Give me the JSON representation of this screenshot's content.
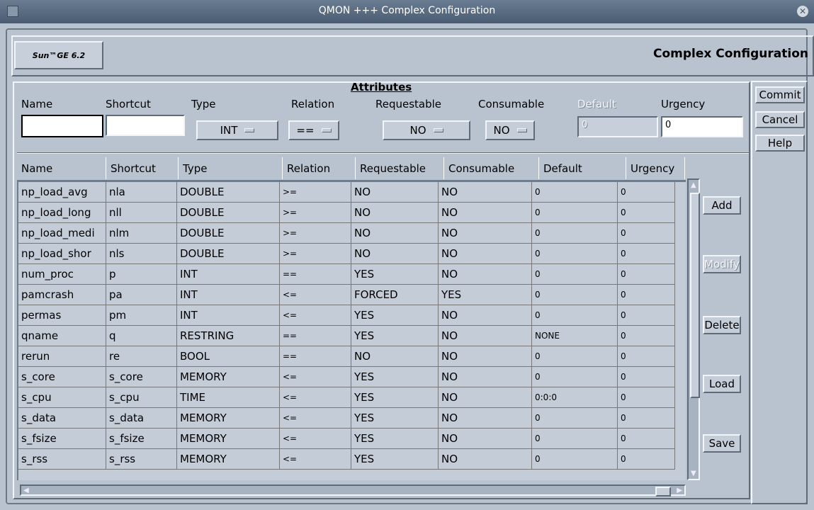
{
  "window": {
    "title": "QMON +++ Complex Configuration"
  },
  "header": {
    "logo": "Sun™GE 6.2",
    "title": "Complex Configuration"
  },
  "attributes": {
    "title": "Attributes",
    "labels": {
      "name": "Name",
      "shortcut": "Shortcut",
      "type": "Type",
      "relation": "Relation",
      "requestable": "Requestable",
      "consumable": "Consumable",
      "default": "Default",
      "urgency": "Urgency"
    },
    "values": {
      "name": "",
      "shortcut": "",
      "type": "INT",
      "relation": "==",
      "requestable": "NO",
      "consumable": "NO",
      "default": "0",
      "urgency": "0"
    }
  },
  "table": {
    "columns": [
      "Name",
      "Shortcut",
      "Type",
      "Relation",
      "Requestable",
      "Consumable",
      "Default",
      "Urgency"
    ],
    "rows": [
      [
        "np_load_avg",
        "nla",
        "DOUBLE",
        ">=",
        "NO",
        "NO",
        "0",
        "0"
      ],
      [
        "np_load_long",
        "nll",
        "DOUBLE",
        ">=",
        "NO",
        "NO",
        "0",
        "0"
      ],
      [
        "np_load_medi",
        "nlm",
        "DOUBLE",
        ">=",
        "NO",
        "NO",
        "0",
        "0"
      ],
      [
        "np_load_shor",
        "nls",
        "DOUBLE",
        ">=",
        "NO",
        "NO",
        "0",
        "0"
      ],
      [
        "num_proc",
        "p",
        "INT",
        "==",
        "YES",
        "NO",
        "0",
        "0"
      ],
      [
        "pamcrash",
        "pa",
        "INT",
        "<=",
        "FORCED",
        "YES",
        "0",
        "0"
      ],
      [
        "permas",
        "pm",
        "INT",
        "<=",
        "YES",
        "NO",
        "0",
        "0"
      ],
      [
        "qname",
        "q",
        "RESTRING",
        "==",
        "YES",
        "NO",
        "NONE",
        "0"
      ],
      [
        "rerun",
        "re",
        "BOOL",
        "==",
        "NO",
        "NO",
        "0",
        "0"
      ],
      [
        "s_core",
        "s_core",
        "MEMORY",
        "<=",
        "YES",
        "NO",
        "0",
        "0"
      ],
      [
        "s_cpu",
        "s_cpu",
        "TIME",
        "<=",
        "YES",
        "NO",
        "0:0:0",
        "0"
      ],
      [
        "s_data",
        "s_data",
        "MEMORY",
        "<=",
        "YES",
        "NO",
        "0",
        "0"
      ],
      [
        "s_fsize",
        "s_fsize",
        "MEMORY",
        "<=",
        "YES",
        "NO",
        "0",
        "0"
      ],
      [
        "s_rss",
        "s_rss",
        "MEMORY",
        "<=",
        "YES",
        "NO",
        "0",
        "0"
      ]
    ]
  },
  "table_buttons": {
    "add": "Add",
    "modify": "Modify",
    "delete": "Delete",
    "load": "Load",
    "save": "Save"
  },
  "dialog_buttons": {
    "commit": "Commit",
    "cancel": "Cancel",
    "help": "Help"
  }
}
